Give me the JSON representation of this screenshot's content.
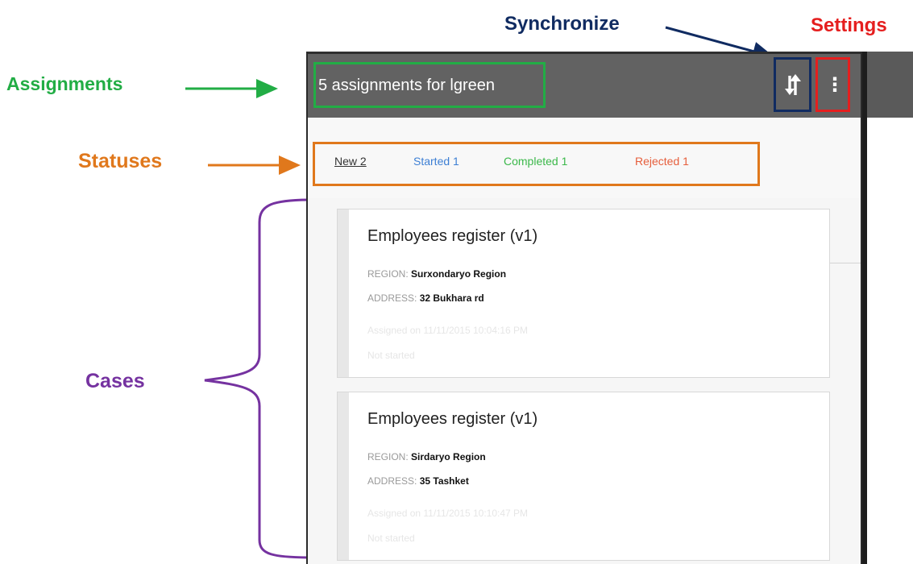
{
  "annotations": {
    "assignments": "Assignments",
    "statuses": "Statuses",
    "cases": "Cases",
    "synchronize": "Synchronize",
    "settings": "Settings"
  },
  "colors": {
    "assignments": "#22ad45",
    "statuses": "#e0781c",
    "cases": "#7532a0",
    "synchronize": "#102b61",
    "settings": "#e51e1e",
    "appbar": "#626262"
  },
  "appbar": {
    "title": "5 assignments for lgreen",
    "sync_icon": "sync-arrows-icon",
    "menu_icon": "more-vertical-icon",
    "menu_glyph": "⋮"
  },
  "tabs": [
    {
      "label": "New 2",
      "color": "#333333"
    },
    {
      "label": "Started 1",
      "color": "#3d7fd4"
    },
    {
      "label": "Completed 1",
      "color": "#3bb84a"
    },
    {
      "label": "Rejected 1",
      "color": "#e65e3c"
    }
  ],
  "cases": [
    {
      "title": "Employees register (v1)",
      "region_label": "REGION:",
      "region_value": "Surxondaryo Region",
      "address_label": "ADDRESS:",
      "address_value": "32 Bukhara rd",
      "assigned": "Assigned on 11/11/2015 10:04:16 PM",
      "status": "Not started"
    },
    {
      "title": "Employees register (v1)",
      "region_label": "REGION:",
      "region_value": "Sirdaryo Region",
      "address_label": "ADDRESS:",
      "address_value": "35 Tashket",
      "assigned": "Assigned on 11/11/2015 10:10:47 PM",
      "status": "Not started"
    }
  ]
}
